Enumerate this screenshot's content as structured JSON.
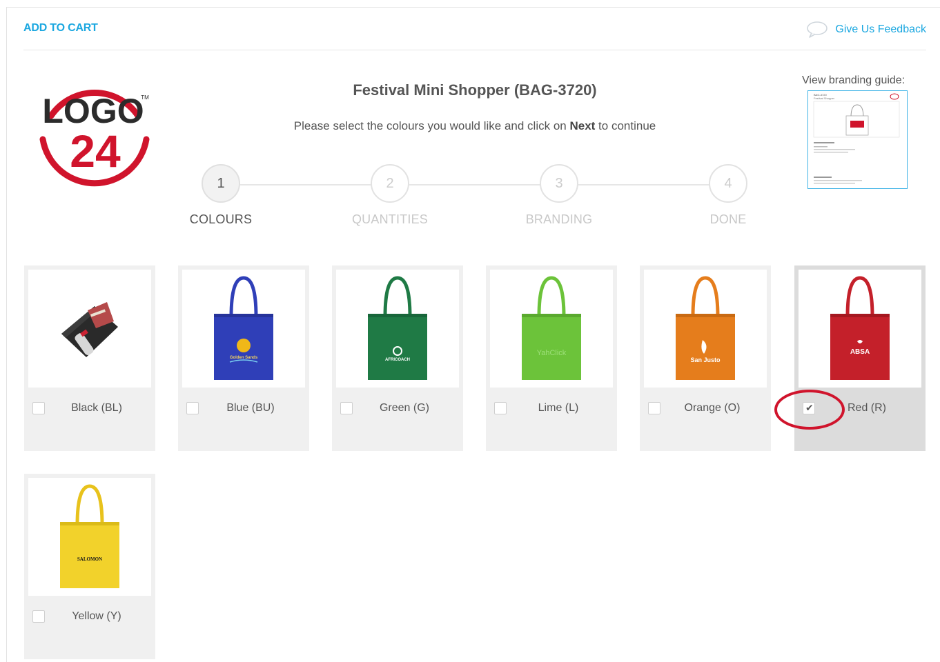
{
  "header": {
    "add_to_cart": "ADD TO CART",
    "feedback": "Give Us Feedback"
  },
  "brand": {
    "logo_word": "LOGO",
    "logo_number": "24",
    "logo_tm": "TM",
    "accent": "#1aa7e0",
    "logo_red": "#d0142c"
  },
  "product": {
    "title": "Festival Mini Shopper (BAG-3720)",
    "instructions_pre": "Please select the colours you would like and click on ",
    "instructions_bold": "Next",
    "instructions_post": " to continue"
  },
  "steps": [
    {
      "number": "1",
      "label": "COLOURS",
      "active": true
    },
    {
      "number": "2",
      "label": "QUANTITIES",
      "active": false
    },
    {
      "number": "3",
      "label": "BRANDING",
      "active": false
    },
    {
      "number": "4",
      "label": "DONE",
      "active": false
    }
  ],
  "branding_guide": {
    "label": "View branding guide:",
    "doc_code": "BAG-3720",
    "doc_name": "Festival Shopper"
  },
  "colours": [
    {
      "label": "Black (BL)",
      "color": "#2a2a2a",
      "checked": false,
      "print": ""
    },
    {
      "label": "Blue (BU)",
      "color": "#2f3fb8",
      "checked": false,
      "print": "Golden Sands"
    },
    {
      "label": "Green (G)",
      "color": "#1f7a45",
      "checked": false,
      "print": "AFRICOACH"
    },
    {
      "label": "Lime (L)",
      "color": "#6cc33a",
      "checked": false,
      "print": "YahClick"
    },
    {
      "label": "Orange (O)",
      "color": "#e57d1c",
      "checked": false,
      "print": "San Justo"
    },
    {
      "label": "Red (R)",
      "color": "#c4202a",
      "checked": true,
      "print": "ABSA"
    },
    {
      "label": "Yellow (Y)",
      "color": "#f2d22b",
      "checked": false,
      "print": "SALOMON"
    }
  ]
}
